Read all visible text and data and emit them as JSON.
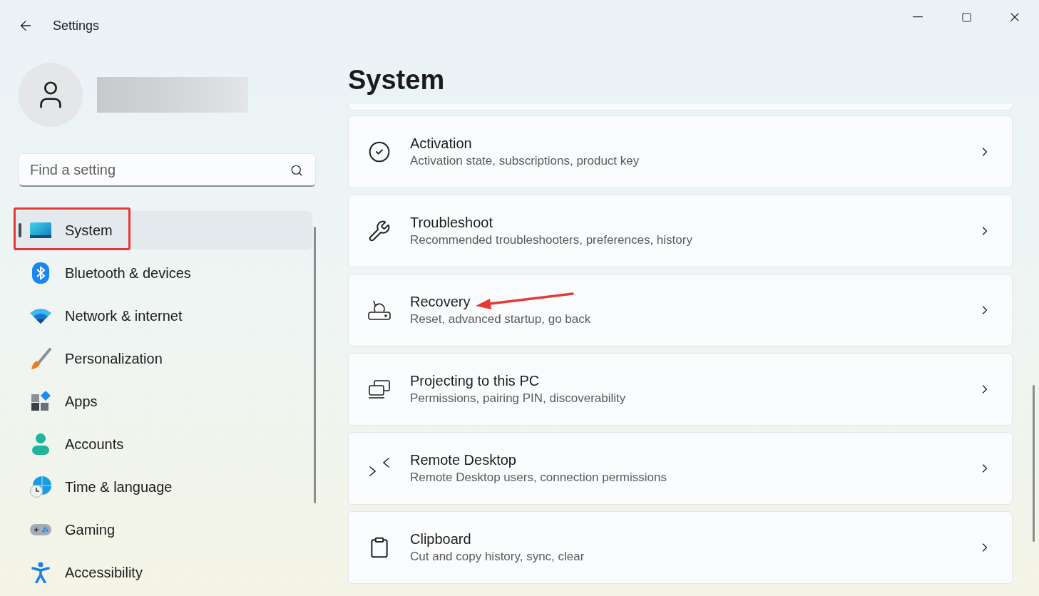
{
  "window": {
    "title": "Settings"
  },
  "search": {
    "placeholder": "Find a setting"
  },
  "sidebar": {
    "items": [
      {
        "label": "System",
        "selected": true,
        "highlighted": true
      },
      {
        "label": "Bluetooth & devices",
        "selected": false,
        "highlighted": false
      },
      {
        "label": "Network & internet",
        "selected": false,
        "highlighted": false
      },
      {
        "label": "Personalization",
        "selected": false,
        "highlighted": false
      },
      {
        "label": "Apps",
        "selected": false,
        "highlighted": false
      },
      {
        "label": "Accounts",
        "selected": false,
        "highlighted": false
      },
      {
        "label": "Time & language",
        "selected": false,
        "highlighted": false
      },
      {
        "label": "Gaming",
        "selected": false,
        "highlighted": false
      },
      {
        "label": "Accessibility",
        "selected": false,
        "highlighted": false
      }
    ]
  },
  "page": {
    "title": "System",
    "cards": [
      {
        "title": "Activation",
        "description": "Activation state, subscriptions, product key",
        "annotated": false
      },
      {
        "title": "Troubleshoot",
        "description": "Recommended troubleshooters, preferences, history",
        "annotated": false
      },
      {
        "title": "Recovery",
        "description": "Reset, advanced startup, go back",
        "annotated": true
      },
      {
        "title": "Projecting to this PC",
        "description": "Permissions, pairing PIN, discoverability",
        "annotated": false
      },
      {
        "title": "Remote Desktop",
        "description": "Remote Desktop users, connection permissions",
        "annotated": false
      },
      {
        "title": "Clipboard",
        "description": "Cut and copy history, sync, clear",
        "annotated": false
      }
    ]
  }
}
